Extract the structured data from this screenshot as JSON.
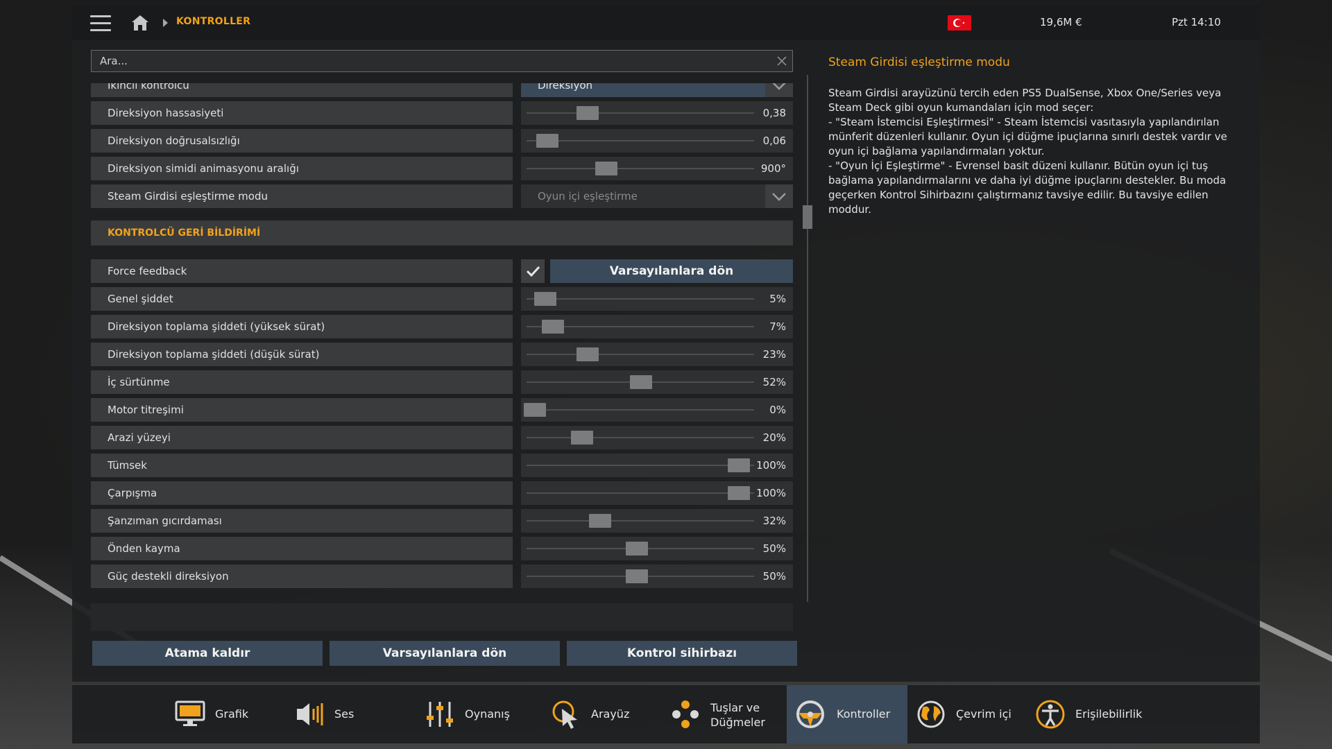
{
  "header": {
    "breadcrumb": "KONTROLLER",
    "money": "19,6M €",
    "clock": "Pzt 14:10"
  },
  "search": {
    "placeholder": "Ara..."
  },
  "rows_top": [
    {
      "label": "İkincil kontrolcü",
      "type": "dropdown",
      "value": "Direksiyon"
    },
    {
      "label": "Direksiyon hassasiyeti",
      "type": "slider",
      "value": "0,38",
      "fraction": 0.26
    },
    {
      "label": "Direksiyon doğrusalsızlığı",
      "type": "slider",
      "value": "0,06",
      "fraction": 0.06
    },
    {
      "label": "Direksiyon simidi animasyonu aralığı",
      "type": "slider",
      "value": "900°",
      "fraction": 0.35
    },
    {
      "label": "Steam Girdisi eşleştirme modu",
      "type": "dropdown",
      "value": "Oyun içi eşleştirme"
    }
  ],
  "section_feedback": {
    "title": "KONTROLCÜ GERİ BİLDİRİMİ",
    "force_feedback": {
      "label": "Force feedback",
      "checked": true,
      "reset_label": "Varsayılanlara dön"
    },
    "sliders": [
      {
        "label": "Genel şiddet",
        "value": "5%",
        "fraction": 0.05
      },
      {
        "label": "Direksiyon toplama şiddeti (yüksek sürat)",
        "value": "7%",
        "fraction": 0.09
      },
      {
        "label": "Direksiyon toplama şiddeti (düşük sürat)",
        "value": "23%",
        "fraction": 0.26
      },
      {
        "label": "İç sürtünme",
        "value": "52%",
        "fraction": 0.52
      },
      {
        "label": "Motor titreşimi",
        "value": "0%",
        "fraction": 0.0
      },
      {
        "label": "Arazi yüzeyi",
        "value": "20%",
        "fraction": 0.23
      },
      {
        "label": "Tümsek",
        "value": "100%",
        "fraction": 1.0
      },
      {
        "label": "Çarpışma",
        "value": "100%",
        "fraction": 1.0
      },
      {
        "label": "Şanzıman gıcırdaması",
        "value": "32%",
        "fraction": 0.32
      },
      {
        "label": "Önden kayma",
        "value": "50%",
        "fraction": 0.5
      },
      {
        "label": "Güç destekli direksiyon",
        "value": "50%",
        "fraction": 0.5
      }
    ]
  },
  "bottom_buttons": {
    "unassign": "Atama kaldır",
    "defaults": "Varsayılanlara dön",
    "wizard": "Kontrol sihirbazı"
  },
  "help": {
    "title": "Steam Girdisi eşleştirme modu",
    "body": "Steam Girdisi arayüzünü tercih eden PS5 DualSense, Xbox One/Series veya Steam Deck gibi oyun kumandaları için mod seçer:\n- \"Steam İstemcisi Eşleştirmesi\" - Steam İstemcisi vasıtasıyla yapılandırılan münferit düzenleri kullanır. Oyun içi düğme ipuçlarına sınırlı destek vardır ve oyun içi bağlama yapılandırmaları yoktur.\n- \"Oyun İçi Eşleştirme\" - Evrensel basit düzeni kullanır. Bütün oyun içi tuş bağlama yapılandırmalarını ve daha iyi düğme ipuçlarını destekler. Bu moda geçerken Kontrol Sihirbazını çalıştırmanız tavsiye edilir. Bu tavsiye edilen moddur."
  },
  "tabs": [
    {
      "id": "grafik",
      "label": "Grafik",
      "icon": "monitor-icon"
    },
    {
      "id": "ses",
      "label": "Ses",
      "icon": "speaker-icon"
    },
    {
      "id": "oynanis",
      "label": "Oynanış",
      "icon": "sliders-icon"
    },
    {
      "id": "arayuz",
      "label": "Arayüz",
      "icon": "cursor-icon"
    },
    {
      "id": "tuslar",
      "label": "Tuşlar ve\nDüğmeler",
      "icon": "gamepad-buttons-icon"
    },
    {
      "id": "kontroller",
      "label": "Kontroller",
      "icon": "steering-wheel-icon",
      "active": true
    },
    {
      "id": "cevrimici",
      "label": "Çevrim içi",
      "icon": "globe-icon"
    },
    {
      "id": "erisilebilirlik",
      "label": "Erişilebilirlik",
      "icon": "accessibility-icon"
    }
  ],
  "colors": {
    "accent": "#f0a21c",
    "button": "#3a4a5a",
    "row": "#3a3b3c"
  }
}
